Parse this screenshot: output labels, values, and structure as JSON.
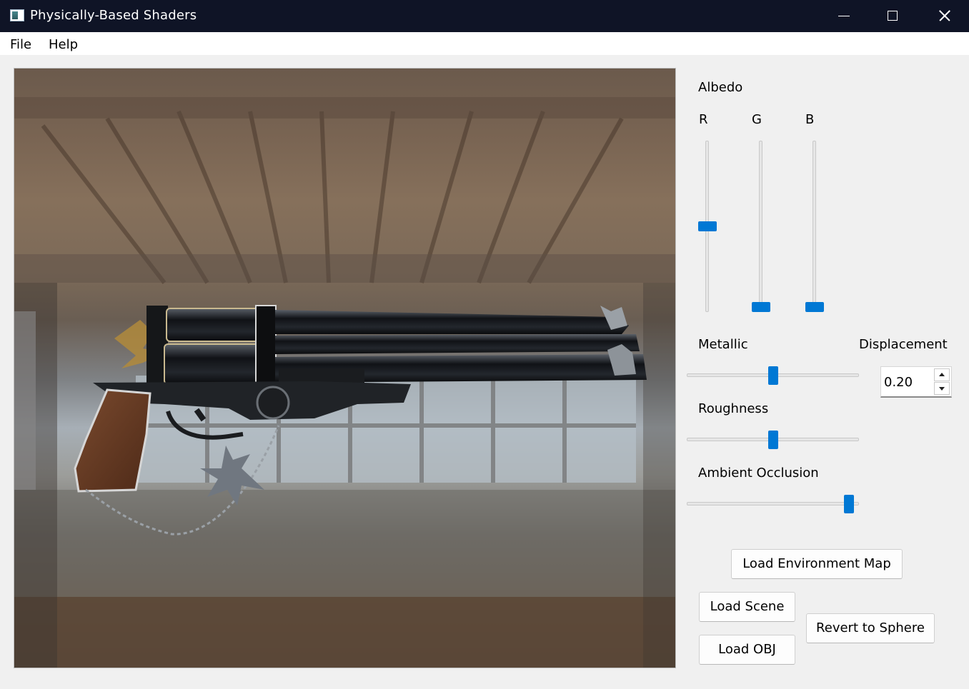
{
  "window": {
    "title": "Physically-Based Shaders"
  },
  "menu": {
    "items": [
      "File",
      "Help"
    ]
  },
  "albedo": {
    "label": "Albedo",
    "channels": [
      {
        "label": "R",
        "value": 0.5
      },
      {
        "label": "G",
        "value": 0.0
      },
      {
        "label": "B",
        "value": 0.0
      }
    ]
  },
  "metallic": {
    "label": "Metallic",
    "value": 0.5
  },
  "roughness": {
    "label": "Roughness",
    "value": 0.5
  },
  "ambient_occlusion": {
    "label": "Ambient Occlusion",
    "value": 0.97
  },
  "displacement": {
    "label": "Displacement",
    "value": "0.20"
  },
  "buttons": {
    "load_env": "Load Environment Map",
    "load_scene": "Load Scene",
    "load_obj": "Load OBJ",
    "revert_sphere": "Revert to Sphere"
  },
  "colors": {
    "accent": "#0078d4",
    "titlebar": "#0f1426"
  }
}
